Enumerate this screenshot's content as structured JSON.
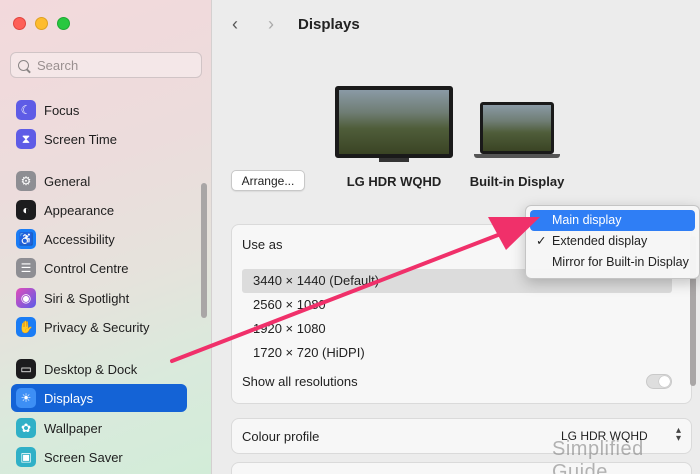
{
  "window": {
    "title": "Displays"
  },
  "search": {
    "placeholder": "Search"
  },
  "sidebar": {
    "items": [
      {
        "label": "Focus",
        "icon": "moon-icon",
        "color": "#5e5ce6",
        "glyph": "☾"
      },
      {
        "label": "Screen Time",
        "icon": "hourglass-icon",
        "color": "#5e5ce6",
        "glyph": "⧗"
      },
      {
        "label": "General",
        "icon": "gear-icon",
        "color": "#8e8e93",
        "glyph": "⚙"
      },
      {
        "label": "Appearance",
        "icon": "appearance-icon",
        "color": "#1c1c1e",
        "glyph": "◐"
      },
      {
        "label": "Accessibility",
        "icon": "accessibility-icon",
        "color": "#1a7cf5",
        "glyph": "♿"
      },
      {
        "label": "Control Centre",
        "icon": "control-centre-icon",
        "color": "#8e8e93",
        "glyph": "☰"
      },
      {
        "label": "Siri & Spotlight",
        "icon": "siri-icon",
        "color": "#b84dd8",
        "glyph": "◉"
      },
      {
        "label": "Privacy & Security",
        "icon": "hand-icon",
        "color": "#1a7cf5",
        "glyph": "✋"
      },
      {
        "label": "Desktop & Dock",
        "icon": "dock-icon",
        "color": "#1c1c1e",
        "glyph": "▭"
      },
      {
        "label": "Displays",
        "icon": "sun-icon",
        "color": "#1a7cf5",
        "glyph": "☀"
      },
      {
        "label": "Wallpaper",
        "icon": "wallpaper-icon",
        "color": "#30b0c7",
        "glyph": "✿"
      },
      {
        "label": "Screen Saver",
        "icon": "screen-saver-icon",
        "color": "#30b0c7",
        "glyph": "▣"
      }
    ]
  },
  "displays": {
    "arrange_label": "Arrange...",
    "external_name": "LG HDR WQHD",
    "builtin_name": "Built-in Display"
  },
  "use_as": {
    "label": "Use as"
  },
  "resolutions": [
    "3440 × 1440 (Default)",
    "2560 × 1080",
    "1920 × 1080",
    "1720 × 720 (HiDPI)"
  ],
  "show_all_label": "Show all resolutions",
  "colour_profile": {
    "label": "Colour profile",
    "value": "LG HDR WQHD"
  },
  "menu": {
    "items": [
      {
        "label": "Main display",
        "checked": false,
        "highlighted": true
      },
      {
        "label": "Extended display",
        "checked": true,
        "highlighted": false
      },
      {
        "label": "Mirror for Built-in Display",
        "checked": false,
        "highlighted": false
      }
    ]
  },
  "watermark": "Simplified Guide",
  "colors": {
    "accent": "#1463d6",
    "annotation_arrow": "#f0306a",
    "menu_highlight": "#2f7ef5"
  }
}
